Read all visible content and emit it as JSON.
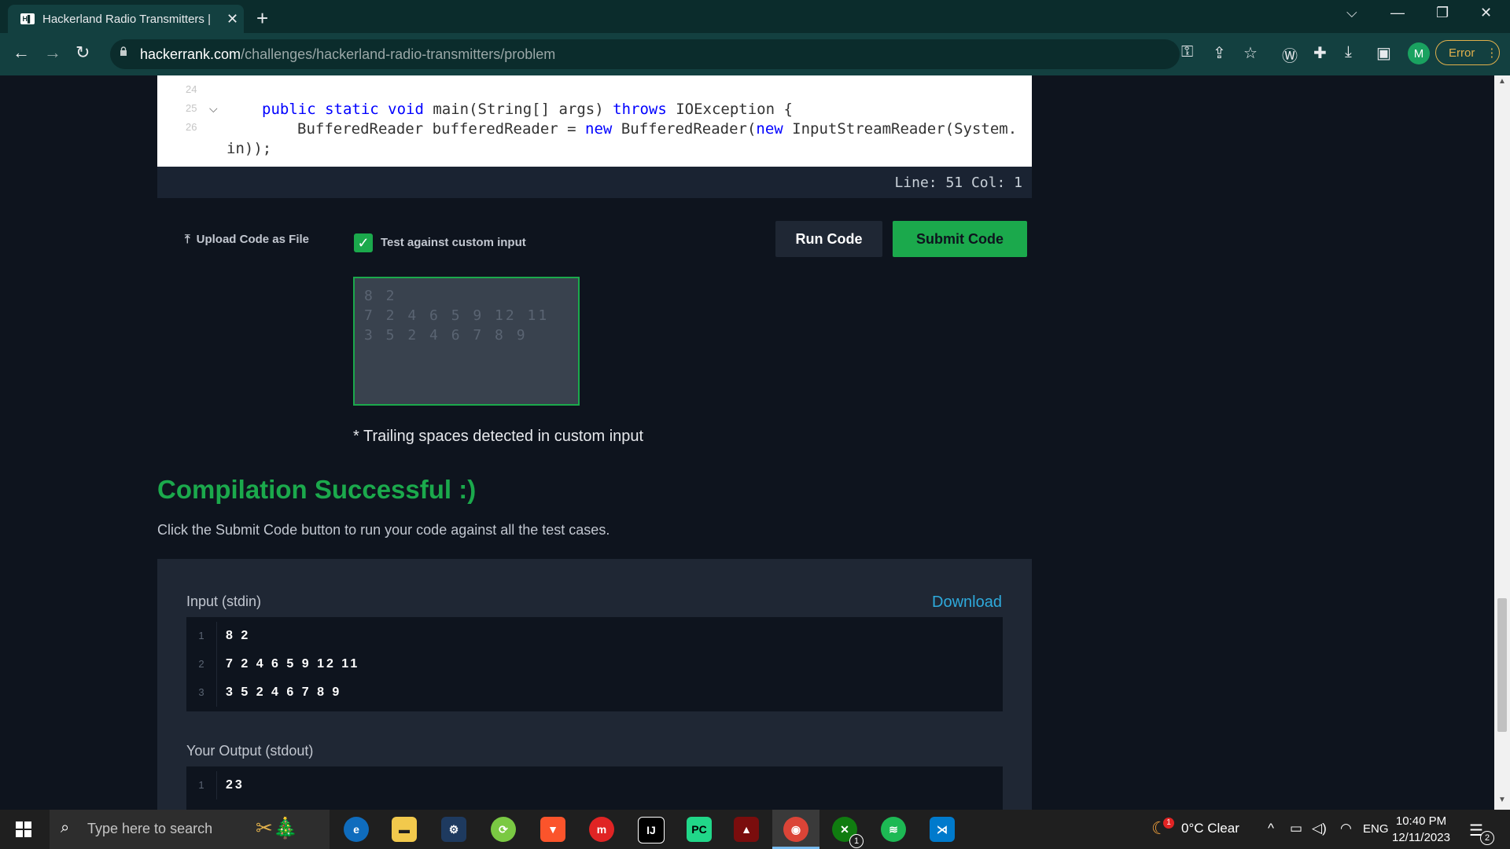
{
  "browser": {
    "tab_title": "Hackerland Radio Transmitters |",
    "favicon_text": "H▌",
    "url_host": "hackerrank.com",
    "url_path": "/challenges/hackerland-radio-transmitters/problem",
    "profile_initial": "M",
    "error_label": "Error"
  },
  "editor": {
    "line_numbers": [
      "24",
      "25",
      "26"
    ],
    "line25": "public static void main(String[] args) throws IOException {",
    "line26a": "BufferedReader bufferedReader = new BufferedReader(new InputStreamReader(System.",
    "line26b": "in));",
    "status": "Line: 51 Col: 1"
  },
  "actions": {
    "upload_label": "Upload Code as File",
    "custom_input_label": "Test against custom input",
    "run_label": "Run Code",
    "submit_label": "Submit Code",
    "custom_input_lines": [
      "8 2",
      "7 2 4 6 5 9 12 11",
      "3 5 2 4 6 7 8 9"
    ],
    "trailing_warning": "* Trailing spaces detected in custom input"
  },
  "result": {
    "title": "Compilation Successful :)",
    "subtitle": "Click the Submit Code button to run your code against all the test cases.",
    "input_label": "Input (stdin)",
    "download_label": "Download",
    "input_lines": [
      {
        "n": "1",
        "v": "8 2"
      },
      {
        "n": "2",
        "v": "7 2 4 6 5 9 12 11"
      },
      {
        "n": "3",
        "v": "3 5 2 4 6 7 8 9"
      }
    ],
    "output_label": "Your Output (stdout)",
    "output_lines": [
      {
        "n": "1",
        "v": "23"
      }
    ]
  },
  "taskbar": {
    "search_placeholder": "Type here to search",
    "weather": "0°C  Clear",
    "language": "ENG",
    "time": "10:40 PM",
    "date": "12/11/2023",
    "notification_count": "2",
    "xbox_badge": "1",
    "weather_badge": "1"
  },
  "colors": {
    "accent_green": "#1ba94c",
    "page_bg": "#0e141e",
    "link_blue": "#2eaadc"
  }
}
